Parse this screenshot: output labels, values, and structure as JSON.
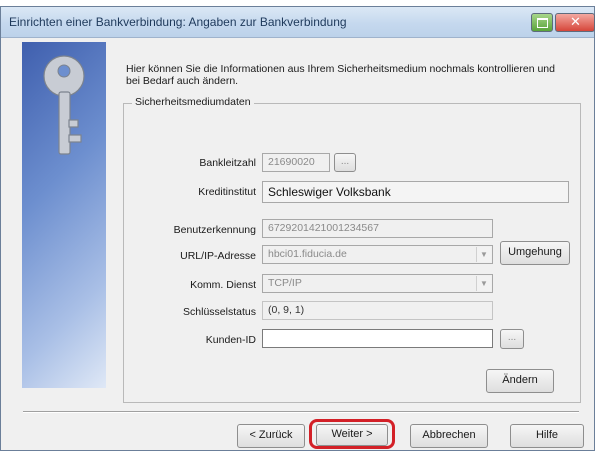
{
  "window": {
    "title": "Einrichten einer Bankverbindung: Angaben zur Bankverbindung",
    "restore_icon": "restore-icon",
    "close_icon": "close-icon",
    "close_glyph": "✕"
  },
  "intro_text": "Hier können Sie die Informationen aus Ihrem Sicherheitsmedium nochmals kontrollieren und bei Bedarf auch ändern.",
  "group": {
    "label": "Sicherheitsmediumdaten",
    "bankleitzahl": {
      "label": "Bankleitzahl",
      "value": "21690020",
      "button": "..."
    },
    "kreditinstitut": {
      "label": "Kreditinstitut",
      "value": "Schleswiger Volksbank"
    },
    "benutzerkennung": {
      "label": "Benutzerkennung",
      "value": "6729201421001234567"
    },
    "url": {
      "label": "URL/IP-Adresse",
      "value": "hbci01.fiducia.de",
      "button": "Umgehung"
    },
    "komm_dienst": {
      "label": "Komm. Dienst",
      "value": "TCP/IP"
    },
    "schluesselstatus": {
      "label": "Schlüsselstatus",
      "value": "(0, 9, 1)"
    },
    "kunden_id": {
      "label": "Kunden-ID",
      "value": "",
      "button": "..."
    },
    "aendern_button": "Ändern"
  },
  "footer": {
    "back": "< Zurück",
    "next": "Weiter >",
    "cancel": "Abbrechen",
    "help": "Hilfe"
  },
  "colors": {
    "highlight": "#d32027",
    "title_text": "#1e395b",
    "panel_blue": "#3f5fae"
  }
}
